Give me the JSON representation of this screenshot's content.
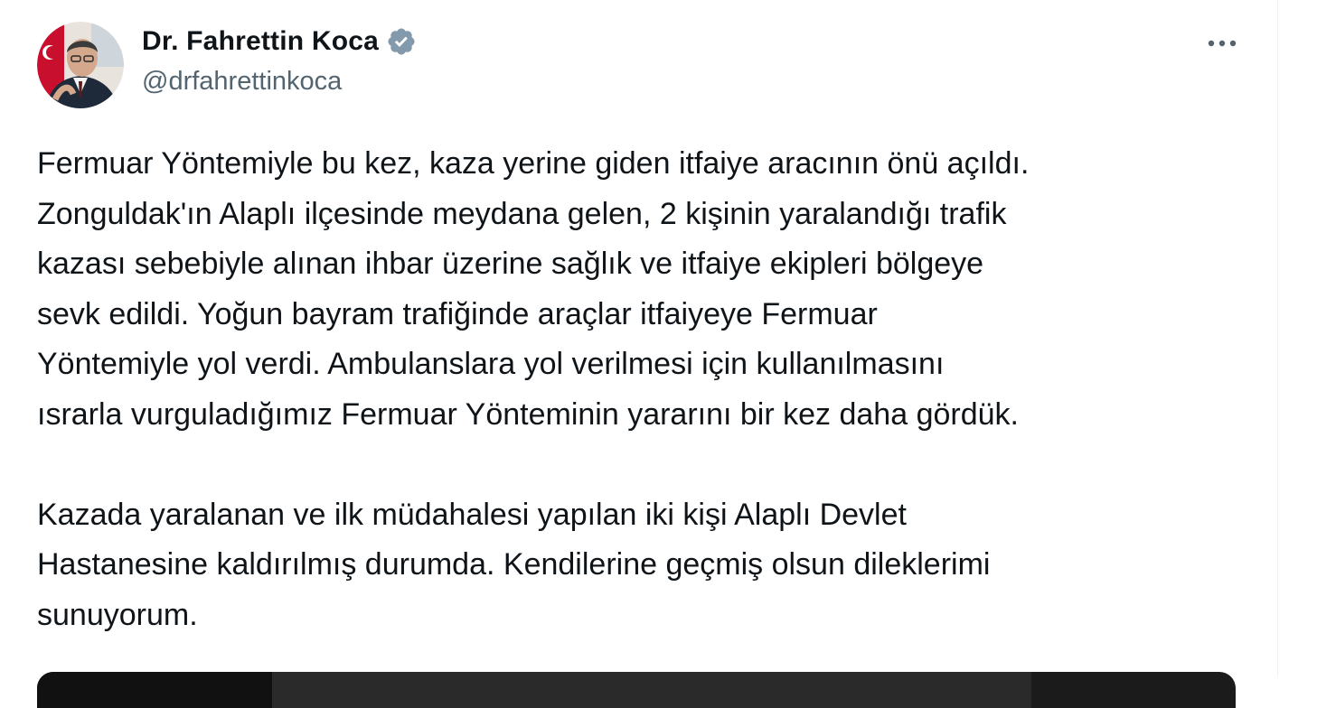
{
  "author": {
    "display_name": "Dr. Fahrettin Koca",
    "handle": "@drfahrettinkoca",
    "verified": true,
    "avatar_icon": "profile-photo"
  },
  "menu": {
    "more_icon": "more-horizontal-icon"
  },
  "tweet": {
    "paragraph1_lines": [
      "Fermuar Yöntemiyle bu kez, kaza yerine giden itfaiye aracının önü açıldı.",
      "Zonguldak'ın Alaplı ilçesinde meydana gelen, 2 kişinin yaralandığı trafik",
      "kazası sebebiyle alınan ihbar üzerine sağlık ve itfaiye ekipleri bölgeye",
      "sevk edildi. Yoğun bayram trafiğinde araçlar itfaiyeye Fermuar",
      "Yöntemiyle yol verdi. Ambulanslara yol verilmesi için kullanılmasını",
      "ısrarla vurguladığımız Fermuar Yönteminin yararını bir kez daha gördük."
    ],
    "paragraph2_lines": [
      "Kazada yaralanan ve ilk müdahalesi yapılan iki kişi Alaplı Devlet",
      "Hastanesine kaldırılmış durumda. Kendilerine geçmiş olsun dileklerimi",
      "sunuyorum."
    ]
  },
  "colors": {
    "text_primary": "#0f1419",
    "text_secondary": "#536471",
    "verified_badge": "#829aab"
  }
}
